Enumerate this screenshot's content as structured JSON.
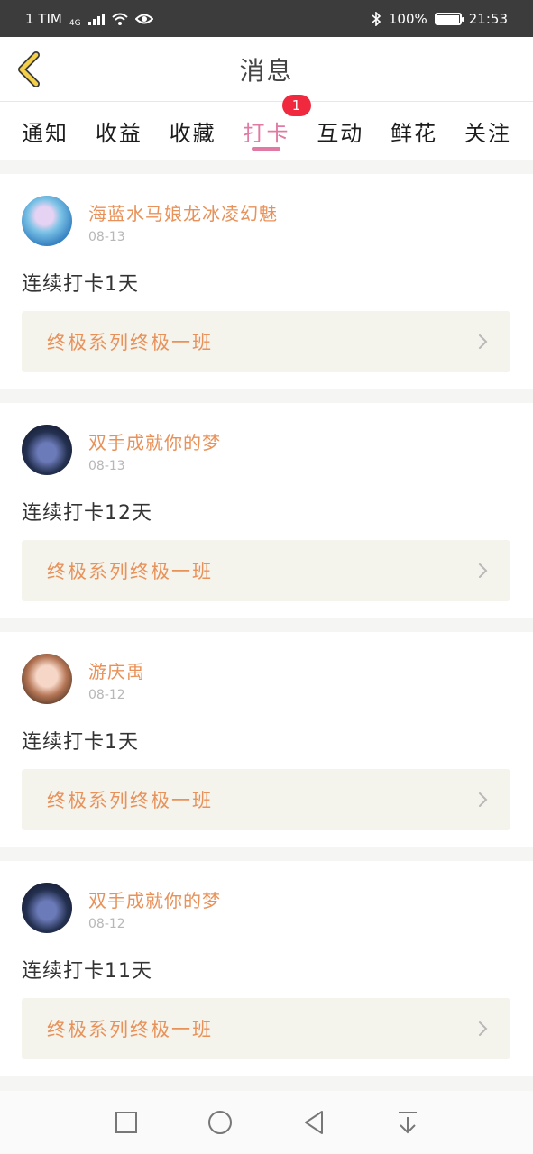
{
  "status_bar": {
    "carrier": "1 TIM",
    "network": "4G",
    "battery": "100%",
    "time": "21:53"
  },
  "header": {
    "title": "消息"
  },
  "tabs": [
    {
      "label": "通知",
      "active": false
    },
    {
      "label": "收益",
      "active": false
    },
    {
      "label": "收藏",
      "active": false
    },
    {
      "label": "打卡",
      "active": true,
      "badge": "1"
    },
    {
      "label": "互动",
      "active": false
    },
    {
      "label": "鲜花",
      "active": false
    },
    {
      "label": "关注",
      "active": false
    }
  ],
  "feed": [
    {
      "username": "海蓝水马娘龙冰凌幻魅",
      "date": "08-13",
      "text": "连续打卡1天",
      "class_name": "终极系列终极一班"
    },
    {
      "username": "双手成就你的梦",
      "date": "08-13",
      "text": "连续打卡12天",
      "class_name": "终极系列终极一班"
    },
    {
      "username": "游庆禹",
      "date": "08-12",
      "text": "连续打卡1天",
      "class_name": "终极系列终极一班"
    },
    {
      "username": "双手成就你的梦",
      "date": "08-12",
      "text": "连续打卡11天",
      "class_name": "终极系列终极一班"
    }
  ],
  "colors": {
    "accent_pink": "#e07aa4",
    "username_orange": "#e8925a",
    "badge_red": "#f0293f",
    "back_yellow": "#f5d04a"
  },
  "icons": [
    "back-arrow-icon",
    "chevron-right-icon",
    "square-icon",
    "circle-icon",
    "triangle-back-icon",
    "download-arrow-icon"
  ]
}
